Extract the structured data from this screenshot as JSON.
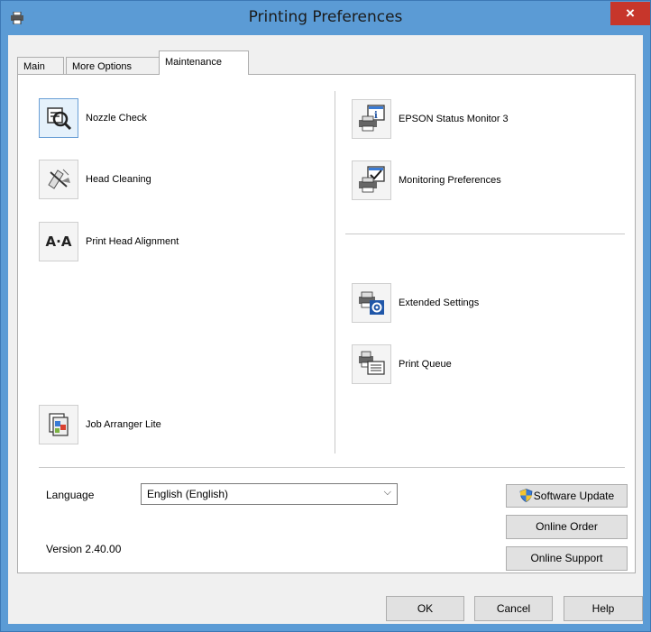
{
  "window": {
    "title": "Printing Preferences",
    "close_symbol": "×"
  },
  "tabs": [
    {
      "label": "Main"
    },
    {
      "label": "More Options"
    },
    {
      "label": "Maintenance",
      "active": true
    }
  ],
  "left_tools": [
    {
      "label": "Nozzle Check",
      "icon": "nozzle-check-icon"
    },
    {
      "label": "Head Cleaning",
      "icon": "head-cleaning-icon"
    },
    {
      "label": "Print Head Alignment",
      "icon": "print-head-alignment-icon",
      "glyph": "A·A"
    },
    {
      "label": "Job Arranger Lite",
      "icon": "job-arranger-icon"
    }
  ],
  "right_tools": [
    {
      "label": "EPSON Status Monitor 3",
      "icon": "status-monitor-icon"
    },
    {
      "label": "Monitoring Preferences",
      "icon": "monitoring-preferences-icon"
    },
    {
      "label": "Extended Settings",
      "icon": "extended-settings-icon"
    },
    {
      "label": "Print Queue",
      "icon": "print-queue-icon"
    }
  ],
  "language": {
    "label": "Language",
    "value": "English (English)"
  },
  "version": "Version 2.40.00",
  "buttons": {
    "software_update": "Software Update",
    "online_order": "Online Order",
    "online_support": "Online Support",
    "ok": "OK",
    "cancel": "Cancel",
    "help": "Help"
  },
  "colors": {
    "title_bar": "#5b9bd5",
    "close_button": "#c7362b",
    "dialog_background": "#f0f0f0"
  }
}
